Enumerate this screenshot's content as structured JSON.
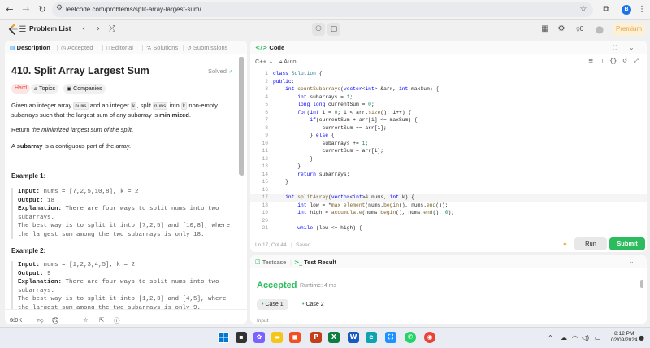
{
  "browser": {
    "url": "leetcode.com/problems/split-array-largest-sum/",
    "profile_initial": "B"
  },
  "appbar": {
    "problem_list_label": "Problem List",
    "streak_count": "0",
    "premium_label": "Premium"
  },
  "left_tabs": [
    {
      "label": "Description",
      "icon": "document-icon"
    },
    {
      "label": "Accepted",
      "icon": "clock-icon"
    },
    {
      "label": "Editorial",
      "icon": "book-icon"
    },
    {
      "label": "Solutions",
      "icon": "flask-icon"
    },
    {
      "label": "Submissions",
      "icon": "history-icon"
    }
  ],
  "problem": {
    "title": "410. Split Array Largest Sum",
    "status": "Solved",
    "difficulty": "Hard",
    "topics_label": "Topics",
    "companies_label": "Companies",
    "desc_1a": "Given an integer array ",
    "desc_1_code1": "nums",
    "desc_1b": " and an integer ",
    "desc_1_code2": "k",
    "desc_1c": ", split ",
    "desc_1_code3": "nums",
    "desc_1d": " into ",
    "desc_1_code4": "k",
    "desc_1e": " non-empty subarrays such that the largest sum of any subarray is ",
    "desc_1_bold": "minimized",
    "desc_1f": ".",
    "desc_2a": "Return ",
    "desc_2_ital": "the minimized largest sum of the split",
    "desc_2b": ".",
    "desc_3_bold": "subarray",
    "desc_3a": "A ",
    "desc_3b": " is a contiguous part of the array.",
    "examples": [
      {
        "title": "Example 1:",
        "input_label": "Input:",
        "input": " nums = [7,2,5,10,8], k = 2",
        "output_label": "Output:",
        "output": " 18",
        "explanation_label": "Explanation:",
        "explanation_1": " There are four ways to split nums into two",
        "explanation_2": "subarrays.",
        "explanation_3": "The best way is to split it into [7,2,5] and [10,8], where",
        "explanation_4": "the largest sum among the two subarrays is only 18."
      },
      {
        "title": "Example 2:",
        "input_label": "Input:",
        "input": " nums = [1,2,3,4,5], k = 2",
        "output_label": "Output:",
        "output": " 9",
        "explanation_label": "Explanation:",
        "explanation_1": " There are four ways to split nums into two",
        "explanation_2": "subarrays.",
        "explanation_3": "The best way is to split it into [1,2,3] and [4,5], where",
        "explanation_4": "the largest sum among the two subarrays is only 9."
      }
    ],
    "likes": "9.9K",
    "comments": "72"
  },
  "code_panel": {
    "title": "Code",
    "language": "C++",
    "mode": "Auto",
    "status": "Ln 17, Col 44",
    "saved": "Saved",
    "run_label": "Run",
    "submit_label": "Submit",
    "lines": [
      "class Solution {",
      "public:",
      "    int countSubarrays(vector<int> &arr, int maxSum) {",
      "        int subarrays = 1;",
      "        long long currentSum = 0;",
      "        for(int i = 0; i < arr.size(); i++) {",
      "            if(currentSum + arr[i] <= maxSum) {",
      "                currentSum += arr[i];",
      "            } else {",
      "                subarrays += 1;",
      "                currentSum = arr[i];",
      "            }",
      "        }",
      "        return subarrays;",
      "    }",
      "",
      "    int splitArray(vector<int>& nums, int k) {",
      "        int low = *max_element(nums.begin(), nums.end());",
      "        int high = accumulate(nums.begin(), nums.end(), 0);",
      "",
      "        while (low <= high) {"
    ]
  },
  "test_panel": {
    "testcase_label": "Testcase",
    "result_label": "Test Result",
    "verdict": "Accepted",
    "runtime": "Runtime: 4 ms",
    "cases": [
      "Case 1",
      "Case 2"
    ],
    "input_label": "Input"
  },
  "taskbar": {
    "time": "8:12 PM",
    "date": "02/09/2024"
  }
}
